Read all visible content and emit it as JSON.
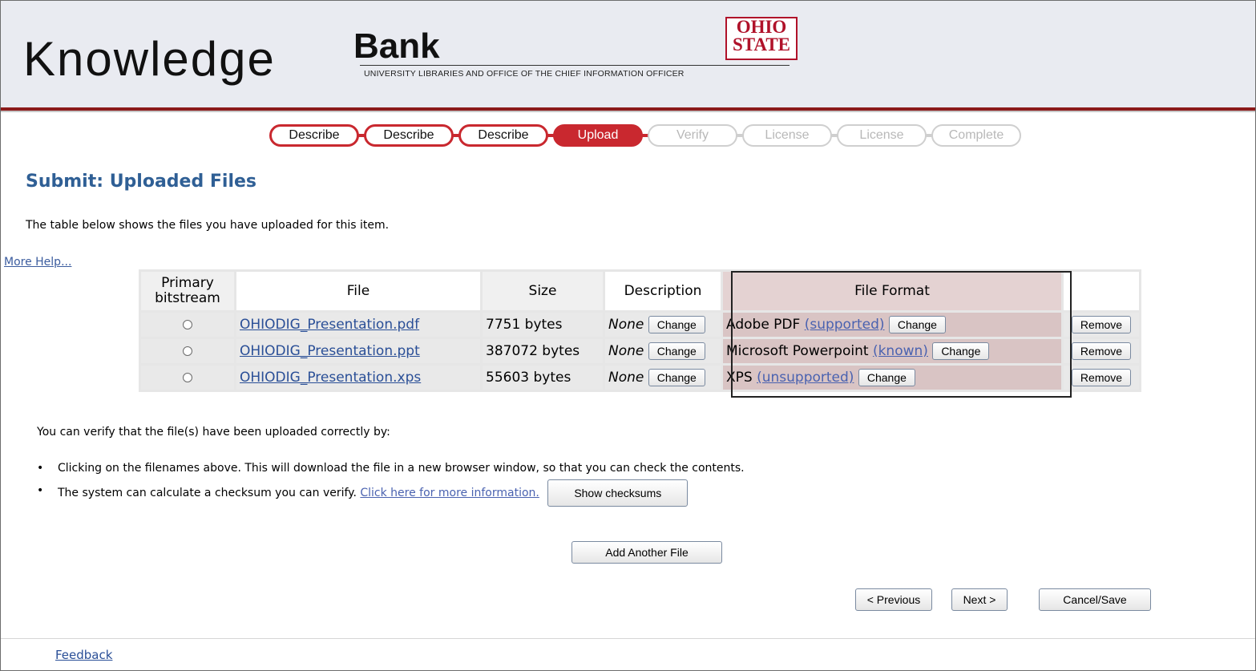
{
  "header": {
    "logo_knowledge": "Knowledge",
    "logo_bank": "Bank",
    "logo_subtitle": "UNIVERSITY LIBRARIES AND OFFICE OF THE CHIEF INFORMATION OFFICER",
    "osu_line1": "OHIO",
    "osu_line2": "STATE",
    "brand_color": "#c9282f"
  },
  "progress": {
    "steps": [
      {
        "label": "Describe",
        "state": "done"
      },
      {
        "label": "Describe",
        "state": "done"
      },
      {
        "label": "Describe",
        "state": "done"
      },
      {
        "label": "Upload",
        "state": "current"
      },
      {
        "label": "Verify",
        "state": "todo"
      },
      {
        "label": "License",
        "state": "todo"
      },
      {
        "label": "License",
        "state": "todo"
      },
      {
        "label": "Complete",
        "state": "todo"
      }
    ]
  },
  "page": {
    "title": "Submit: Uploaded Files",
    "intro": "The table below shows the files you have uploaded for this item.",
    "help_link": "More Help..."
  },
  "table": {
    "headers": {
      "primary_line1": "Primary",
      "primary_line2": "bitstream",
      "file": "File",
      "size": "Size",
      "description": "Description",
      "format": "File Format"
    },
    "rows": [
      {
        "file": "OHIODIG_Presentation.pdf",
        "size": "7751 bytes",
        "description": "None",
        "desc_button": "Change",
        "format": "Adobe PDF",
        "support": "(supported)",
        "format_button": "Change",
        "remove_button": "Remove"
      },
      {
        "file": "OHIODIG_Presentation.ppt",
        "size": "387072 bytes",
        "description": "None",
        "desc_button": "Change",
        "format": "Microsoft Powerpoint",
        "support": "(known)",
        "format_button": "Change",
        "remove_button": "Remove"
      },
      {
        "file": "OHIODIG_Presentation.xps",
        "size": "55603 bytes",
        "description": "None",
        "desc_button": "Change",
        "format": "XPS",
        "support": "(unsupported)",
        "format_button": "Change",
        "remove_button": "Remove"
      }
    ]
  },
  "verify": {
    "intro": "You can verify that the file(s) have been uploaded correctly by:",
    "bullet1": "Clicking on the filenames above. This will download the file in a new browser window, so that you can check the contents.",
    "bullet2_text": "The system can calculate a checksum you can verify.",
    "bullet2_link": "Click here for more information.",
    "checksum_button": "Show checksums"
  },
  "actions": {
    "add_file": "Add Another File",
    "previous": "< Previous",
    "next": "Next >",
    "cancel_save": "Cancel/Save"
  },
  "footer": {
    "feedback": "Feedback"
  }
}
